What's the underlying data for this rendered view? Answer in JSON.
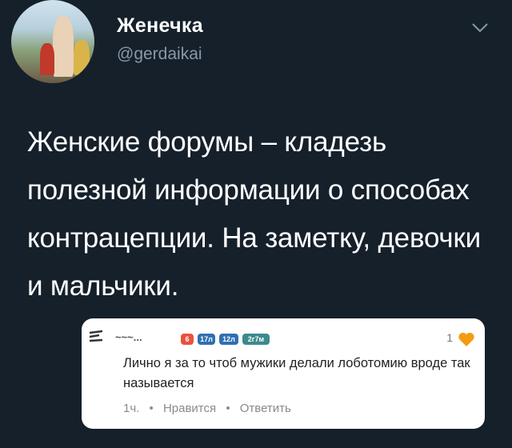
{
  "tweet": {
    "author_name": "Женечка",
    "author_handle": "@gerdaikai",
    "text": "Женские форумы – кладезь полезной информации о способах контрацепции. На заметку, девочки и мальчики."
  },
  "embedded_comment": {
    "username": "~~~...",
    "badges": [
      "6",
      "17л",
      "12л",
      "2г7м"
    ],
    "likes": "1",
    "text": "Лично я за то чтоб мужики делали лоботомию вроде так называется",
    "time": "1ч.",
    "separator": "•",
    "like_action": "Нравится",
    "reply_action": "Ответить"
  },
  "colors": {
    "background": "#15202b",
    "handle_gray": "#8899a6",
    "heart": "#f39c12"
  }
}
